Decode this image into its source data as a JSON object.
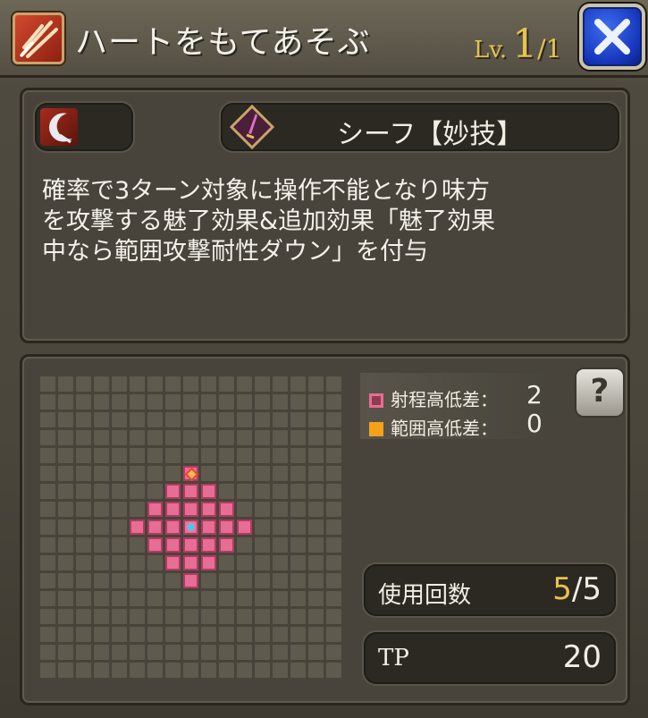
{
  "header": {
    "skill_name": "ハートをもてあそぶ",
    "level_prefix": "Lv.",
    "level_current": "1",
    "level_max": "/1",
    "skill_type_icon": "claw-slash-icon",
    "close_icon": "close-x-icon"
  },
  "info": {
    "element_icon": "crescent-slash-icon",
    "class_icon": "dagger-icon",
    "class_name": "シーフ【妙技】",
    "description": "確率で3ターン対象に操作不能となり味方\nを攻撃する魅了効果&追加効果「魅了効果\n中なら範囲攻撃耐性ダウン」を付与"
  },
  "range": {
    "legend": [
      {
        "label": "射程高低差：",
        "value": "2",
        "color": "#e66d93"
      },
      {
        "label": "範囲高低差：",
        "value": "0",
        "color": "#f4a21c"
      }
    ],
    "help_label": "?",
    "grid_size": 17,
    "center": [
      8,
      8
    ],
    "target_cell": [
      8,
      5
    ],
    "range_rows": [
      {
        "row": 5,
        "cols": [
          8
        ]
      },
      {
        "row": 6,
        "cols": [
          7,
          8,
          9
        ]
      },
      {
        "row": 7,
        "cols": [
          6,
          7,
          8,
          9,
          10
        ]
      },
      {
        "row": 8,
        "cols": [
          5,
          6,
          7,
          8,
          9,
          10,
          11
        ]
      },
      {
        "row": 9,
        "cols": [
          6,
          7,
          8,
          9,
          10
        ]
      },
      {
        "row": 10,
        "cols": [
          7,
          8,
          9
        ]
      },
      {
        "row": 11,
        "cols": [
          8
        ]
      }
    ]
  },
  "stats": {
    "uses_label": "使用回数",
    "uses_current": "5",
    "uses_max": "/5",
    "tp_label": "TP",
    "tp_value": "20"
  },
  "colors": {
    "accent_gold": "#e8c34c",
    "range_pink": "#e66d93",
    "area_orange": "#f4a21c",
    "close_blue": "#1f45d6"
  }
}
